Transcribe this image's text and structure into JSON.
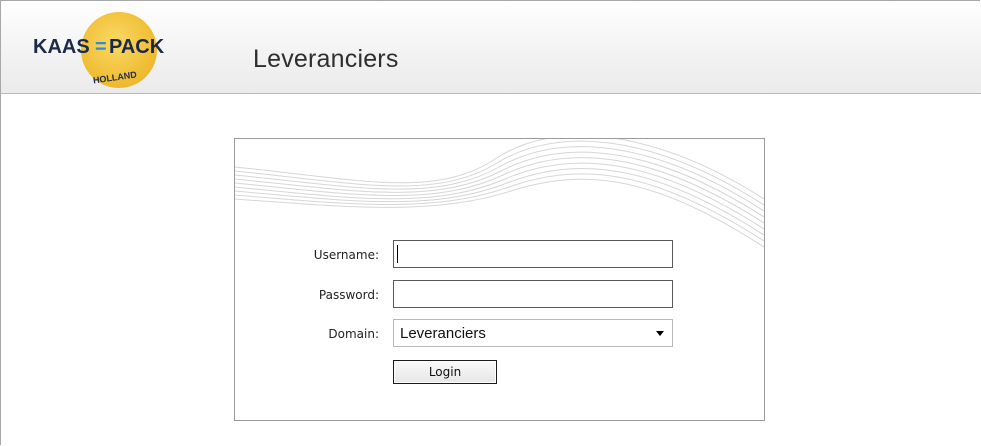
{
  "header": {
    "logo": {
      "brand_left": "KAAS",
      "brand_sep": "=",
      "brand_right": "PACK",
      "sub": "HOLLAND"
    },
    "title": "Leveranciers"
  },
  "login": {
    "username_label": "Username:",
    "username_value": "",
    "password_label": "Password:",
    "password_value": "",
    "domain_label": "Domain:",
    "domain_selected": "Leveranciers",
    "login_button": "Login"
  },
  "colors": {
    "logo_yellow": "#f4c53a",
    "logo_text": "#1b2a4a",
    "logo_accent": "#2e8fd0"
  }
}
